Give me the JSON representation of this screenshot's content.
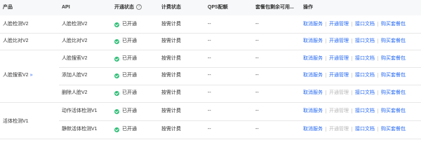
{
  "header": {
    "col_product": "产品",
    "col_api": "API",
    "col_status": "开通状态",
    "col_billing": "计费状态",
    "col_qps": "QPS配额",
    "col_remaining": "套餐包剩余可用...",
    "col_ops": "操作"
  },
  "products": [
    {
      "name": "人脸检测V2"
    },
    {
      "name": "人脸比对V2"
    },
    {
      "name": "人脸搜索V2",
      "expand": "»"
    },
    {
      "name": "活体检测V1"
    }
  ],
  "rows": [
    {
      "api": "人脸检测V2",
      "status": "已开通",
      "billing": "按需计费",
      "qps": "--",
      "remaining": "--"
    },
    {
      "api": "人脸比对V2",
      "status": "已开通",
      "billing": "按需计费",
      "qps": "--",
      "remaining": "--"
    },
    {
      "api": "人脸搜索V2",
      "status": "已开通",
      "billing": "按需计费",
      "qps": "--",
      "remaining": "--"
    },
    {
      "api": "添加人脸V2",
      "status": "已开通",
      "billing": "按需计费",
      "qps": "--",
      "remaining": "--"
    },
    {
      "api": "删除人脸V2",
      "status": "已开通",
      "billing": "按需计费",
      "qps": "--",
      "remaining": "--"
    },
    {
      "api": "动作活体检测V1",
      "status": "已开通",
      "billing": "按需计费",
      "qps": "--",
      "remaining": "--"
    },
    {
      "api": "静默活体检测V1",
      "status": "已开通",
      "billing": "按需计费",
      "qps": "--",
      "remaining": "--"
    }
  ],
  "ops": {
    "cancel": "取消服务",
    "manage": "开通管理",
    "docs": "接口文档",
    "buy": "购买套餐包"
  },
  "colors": {
    "link": "#2468f2",
    "disabled": "#b8b8b8",
    "status_ok": "#30bf78",
    "header_bg": "#f7f8fa"
  }
}
